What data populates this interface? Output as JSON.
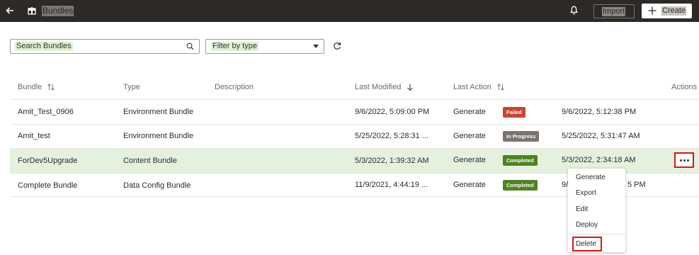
{
  "header": {
    "title": "Bundles",
    "import_label": "Import",
    "create_label": "Create",
    "icons": [
      "back-arrow-icon",
      "bundle-icon",
      "bell-icon",
      "plus-icon"
    ]
  },
  "filters": {
    "search_placeholder": "Search Bundles",
    "type_placeholder": "Filter by type",
    "icons": [
      "search-icon",
      "chevron-down-icon",
      "refresh-icon"
    ]
  },
  "table": {
    "columns": {
      "bundle": "Bundle",
      "type": "Type",
      "description": "Description",
      "last_modified": "Last Modified",
      "last_action": "Last Action",
      "actions": "Actions"
    },
    "rows": [
      {
        "bundle": "Amit_Test_0906",
        "type": "Environment Bundle",
        "description": "",
        "last_modified": "9/6/2022, 5:09:00 PM",
        "action": "Generate",
        "status": "Failed",
        "status_color": "#c74634",
        "action_time": "9/6/2022, 5:12:38 PM"
      },
      {
        "bundle": "Amit_test",
        "type": "Environment Bundle",
        "description": "",
        "last_modified": "5/25/2022, 5:28:31 ...",
        "action": "Generate",
        "status": "In Progress",
        "status_color": "#7a736e",
        "action_time": "5/25/2022, 5:31:47 AM"
      },
      {
        "bundle": "ForDev5Upgrade",
        "type": "Content Bundle",
        "description": "",
        "last_modified": "5/3/2022, 1:39:32 AM",
        "action": "Generate",
        "status": "Completed",
        "status_color": "#508223",
        "action_time": "5/3/2022, 2:34:18 AM"
      },
      {
        "bundle": "Complete Bundle",
        "type": "Data Config Bundle",
        "description": "",
        "last_modified": "11/9/2021, 4:44:19 ...",
        "action": "Generate",
        "status": "Completed",
        "status_color": "#508223",
        "action_time_left": "9/",
        "action_time_right": "5 PM"
      }
    ],
    "selected_row_color": "#e4f1dc"
  },
  "actions_menu": {
    "items": [
      "Generate",
      "Export",
      "Edit",
      "Deploy",
      "Delete"
    ],
    "highlight_color": "#d11919"
  }
}
